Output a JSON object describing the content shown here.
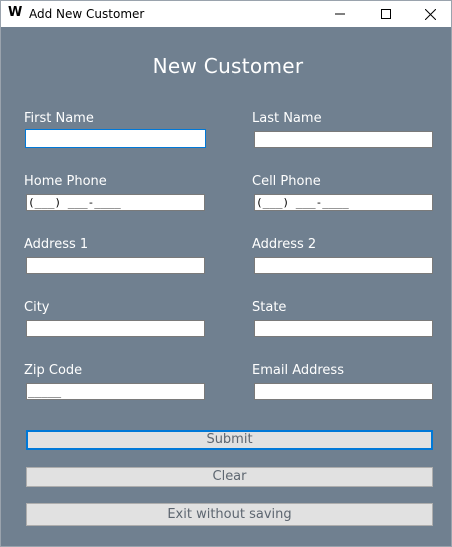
{
  "window": {
    "title": "Add New Customer",
    "app_icon_glyph": "W"
  },
  "form": {
    "heading": "New Customer",
    "fields": {
      "first_name": {
        "label": "First Name",
        "value": ""
      },
      "last_name": {
        "label": "Last Name",
        "value": ""
      },
      "home_phone": {
        "label": "Home Phone",
        "value": "(___) ___-____"
      },
      "cell_phone": {
        "label": "Cell Phone",
        "value": "(___) ___-____"
      },
      "address1": {
        "label": "Address 1",
        "value": ""
      },
      "address2": {
        "label": "Address 2",
        "value": ""
      },
      "city": {
        "label": "City",
        "value": ""
      },
      "state": {
        "label": "State",
        "value": ""
      },
      "zip": {
        "label": "Zip Code",
        "value": "_____"
      },
      "email": {
        "label": "Email Address",
        "value": ""
      }
    }
  },
  "buttons": {
    "submit": "Submit",
    "clear": "Clear",
    "exit": "Exit without saving"
  },
  "colors": {
    "form_background": "#708090",
    "focus_accent": "#0078d7",
    "button_face": "#e1e1e1"
  }
}
